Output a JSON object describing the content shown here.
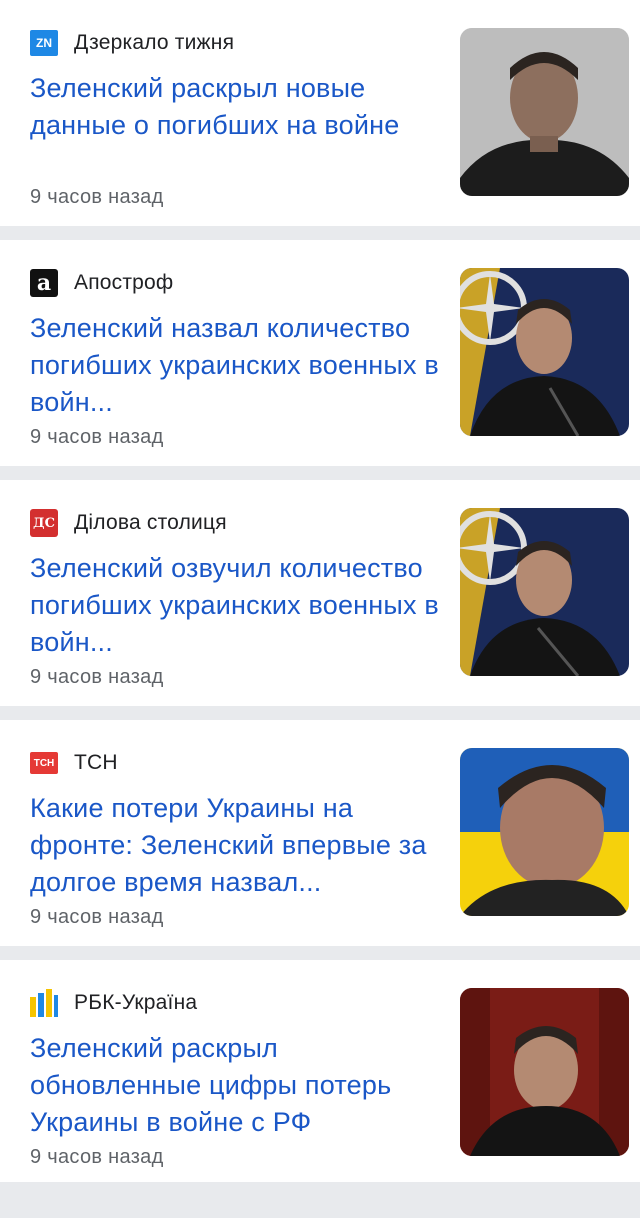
{
  "articles": [
    {
      "source": "Дзеркало тижня",
      "source_logo": "ZN",
      "logo_color": "#1e88e5",
      "headline": "Зеленский раскрыл новые данные о погибших на войне",
      "time": "9 часов назад",
      "thumb_icon": "person-photo-dark"
    },
    {
      "source": "Апостроф",
      "source_logo": "a",
      "logo_color": "#111111",
      "headline": "Зеленский назвал количество погибших украинских военных в войн...",
      "time": "9 часов назад",
      "thumb_icon": "person-photo-nato"
    },
    {
      "source": "Ділова столиця",
      "source_logo": "ДС",
      "logo_color": "#d32f2f",
      "headline": "Зеленский озвучил количество погибших украинских военных в войн...",
      "time": "9 часов назад",
      "thumb_icon": "person-photo-nato"
    },
    {
      "source": "ТСН",
      "source_logo": "ТСН",
      "logo_color": "#e53935",
      "headline": "Какие потери Украины на фронте: Зеленский впервые за долгое время назвал...",
      "time": "9 часов назад",
      "thumb_icon": "person-photo-flag"
    },
    {
      "source": "РБК-Україна",
      "source_logo": "",
      "logo_color": "#1976d2",
      "headline": "Зеленский раскрыл обновленные цифры потерь Украины в войне с РФ",
      "time": "9 часов назад",
      "thumb_icon": "person-photo-curtain"
    }
  ]
}
